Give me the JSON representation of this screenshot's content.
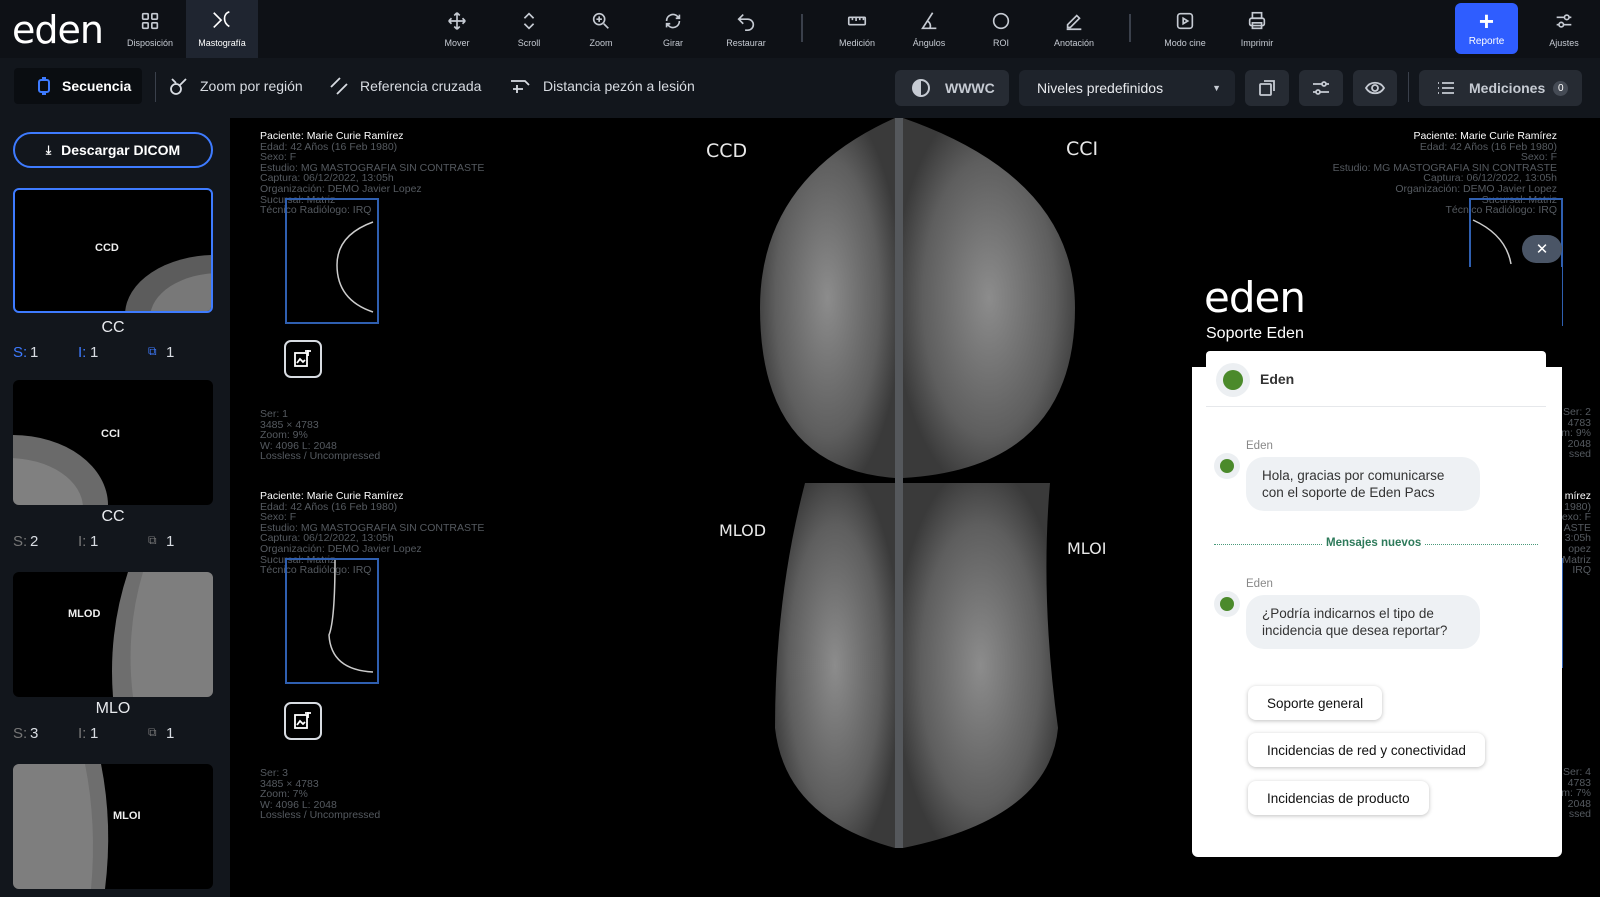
{
  "brand": {
    "logo": "eden"
  },
  "toolbar": {
    "disposicion": "Disposición",
    "mastografia": "Mastografía",
    "mover": "Mover",
    "scroll": "Scroll",
    "zoom": "Zoom",
    "girar": "Girar",
    "restaurar": "Restaurar",
    "medicion": "Medición",
    "angulos": "Ángulos",
    "roi": "ROI",
    "anotacion": "Anotación",
    "modo_cine": "Modo cine",
    "imprimir": "Imprimir",
    "reporte": "Reporte",
    "ajustes": "Ajustes"
  },
  "subbar": {
    "secuencia": "Secuencia",
    "zoom_region": "Zoom por región",
    "referencia": "Referencia cruzada",
    "distancia": "Distancia pezón a lesión",
    "wwwc": "WWWC",
    "niveles": "Niveles predefinidos",
    "mediciones": "Mediciones",
    "mediciones_count": "0"
  },
  "sidebar": {
    "download": "Descargar DICOM",
    "thumbs": [
      {
        "label": "CCD",
        "title": "CC",
        "s": "S:",
        "s_val": "1",
        "i": "I:",
        "i_val": "1",
        "c_val": "1"
      },
      {
        "label": "CCI",
        "title": "CC",
        "s": "S:",
        "s_val": "2",
        "i": "I:",
        "i_val": "1",
        "c_val": "1"
      },
      {
        "label": "MLOD",
        "title": "MLO",
        "s": "S:",
        "s_val": "3",
        "i": "I:",
        "i_val": "1",
        "c_val": "1"
      },
      {
        "label": "MLOI"
      }
    ]
  },
  "viewer": {
    "meta1": {
      "paciente": "Paciente: Marie Curie Ramírez",
      "edad": "Edad: 42 Años (16 Feb 1980)",
      "sexo": "Sexo: F",
      "estudio": "Estudio: MG MASTOGRAFIA SIN CONTRASTE",
      "captura": "Captura: 06/12/2022, 13:05h",
      "org": "Organización: DEMO Javier Lopez",
      "sucursal": "Sucursal: Matriz",
      "tecnico": "Técnico Radiólogo: IRQ"
    },
    "series1": {
      "ser": "Ser: 1",
      "dim": "3485 × 4783",
      "zoom": "Zoom: 9%",
      "wl": "W: 4096 L: 2048",
      "comp": "Lossless / Uncompressed"
    },
    "series3": {
      "ser": "Ser: 3",
      "dim": "3485 × 4783",
      "zoom": "Zoom: 7%",
      "wl": "W: 4096 L: 2048",
      "comp": "Lossless / Uncompressed"
    },
    "right_frag": {
      "ser2": "Ser: 2",
      "d2": "4783",
      "z2": "m: 9%",
      "w2": "2048",
      "c2": "ssed",
      "ser4": "Ser: 4",
      "d4": "4783",
      "z4": "m: 7%",
      "w4": "2048",
      "c4": "ssed",
      "r1": "mírez",
      "r2": "1980)",
      "r3": "exo: F",
      "r4": "ASTE",
      "r5": "3:05h",
      "r6": "opez",
      "r7": "Matriz",
      "r8": "IRQ"
    },
    "labels": {
      "ccd": "CCD",
      "cci": "CCI",
      "mlod": "MLOD",
      "mloi": "MLOI"
    }
  },
  "chat": {
    "logo": "eden",
    "title": "Soporte Eden",
    "agent": "Eden",
    "sender1": "Eden",
    "msg1": "Hola, gracias por comunicarse con el soporte de Eden Pacs",
    "divider": "Mensajes nuevos",
    "sender2": "Eden",
    "msg2": "¿Podría indicarnos el tipo de incidencia que desea reportar?",
    "options": [
      "Soporte general",
      "Incidencias de red y conectividad",
      "Incidencias de producto"
    ],
    "close": "✕"
  }
}
